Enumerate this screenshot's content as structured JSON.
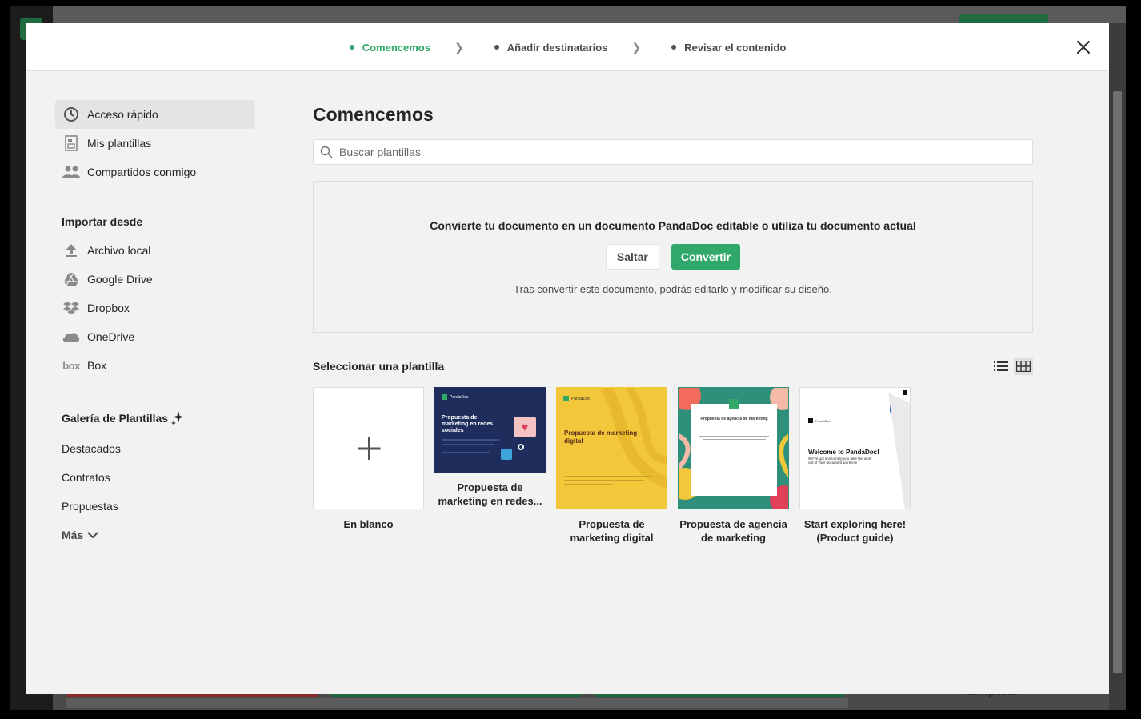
{
  "steps": [
    {
      "label": "Comencemos",
      "active": true
    },
    {
      "label": "Añadir destinatarios",
      "active": false
    },
    {
      "label": "Revisar el contenido",
      "active": false
    }
  ],
  "sidebar": {
    "items": [
      {
        "label": "Acceso rápido",
        "icon": "clock-icon"
      },
      {
        "label": "Mis plantillas",
        "icon": "template-icon"
      },
      {
        "label": "Compartidos conmigo",
        "icon": "people-icon"
      }
    ],
    "import_heading": "Importar desde",
    "import_items": [
      {
        "label": "Archivo local",
        "icon": "upload-icon"
      },
      {
        "label": "Google Drive",
        "icon": "google-drive-icon"
      },
      {
        "label": "Dropbox",
        "icon": "dropbox-icon"
      },
      {
        "label": "OneDrive",
        "icon": "onedrive-icon"
      },
      {
        "label": "Box",
        "icon": "box-icon",
        "logo_text": "box"
      }
    ],
    "gallery_heading": "Galería de Plantillas",
    "gallery_items": [
      "Destacados",
      "Contratos",
      "Propuestas"
    ],
    "more_label": "Más"
  },
  "main": {
    "title": "Comencemos",
    "search_placeholder": "Buscar plantillas",
    "convert": {
      "message": "Convierte tu documento en un documento PandaDoc editable o utiliza tu documento actual",
      "skip_label": "Saltar",
      "convert_label": "Convertir",
      "note": "Tras convertir este documento, podrás editarlo y modificar su diseño."
    },
    "select_heading": "Seleccionar una plantilla",
    "templates": [
      {
        "label": "En blanco"
      },
      {
        "label": "Propuesta de marketing en redes...",
        "thumb_title": "Propuesta de marketing en redes sociales",
        "brand": "PandaDoc"
      },
      {
        "label": "Propuesta de marketing digital",
        "thumb_title": "Propuesta de marketing digital",
        "brand": "PandaDoc"
      },
      {
        "label": "Propuesta de agencia de marketing",
        "thumb_title": "Propuesta de agencia de marketing"
      },
      {
        "label": "Start exploring here! (Product guide)",
        "thumb_title": "Welcome to PandaDoc!",
        "thumb_sub": "We've got tips to help you take the work out of your document workflow",
        "brand": "PandaDoc"
      }
    ]
  },
  "background": {
    "partial_text": "temporal"
  },
  "colors": {
    "accent": "#2fa86a",
    "text": "#242424"
  }
}
